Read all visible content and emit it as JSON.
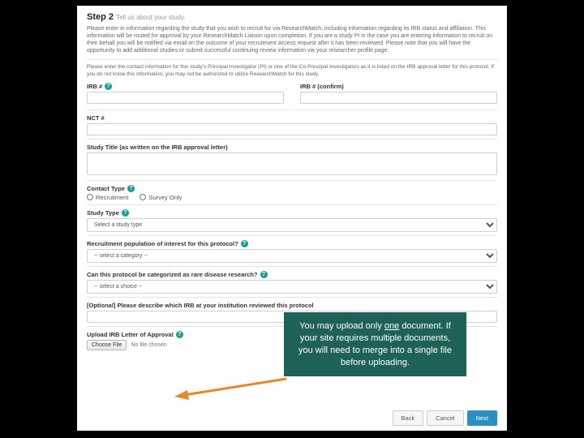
{
  "step": {
    "num": "Step 2",
    "sub": "Tell us about your study."
  },
  "intro": "Please enter in information regarding the study that you wish to recruit for via ResearchMatch, including information regarding its IRB status and affiliation. This information will be routed for approval by your ResearchMatch Liaison upon completion. If you are a study PI in the case you are entering information to recruit on their behalf you will be notified via email on the outcome of your recruitment access request after it has been reviewed. Please note that you will have the opportunity to add additional studies or submit successful continuing review information via your researcher profile page.",
  "pi_note": "Please enter the contact information for this study's Principal Investigator (PI) or one of the Co-Principal Investigators as it is listed on the IRB approval letter for this protocol. If you do not know this information, you may not be authorized to utilize ResearchMatch for this study.",
  "labels": {
    "irb": "IRB #",
    "irb_confirm": "IRB # (confirm)",
    "nct": "NCT #",
    "title": "Study Title (as written on the IRB approval letter)",
    "contact": "Contact Type",
    "recruitment": "Recruitment",
    "survey": "Survey Only",
    "studytype": "Study Type",
    "studytype_ph": "Select a study type",
    "pop": "Recruitment population of interest for this protocol?",
    "pop_ph": "-- select a category --",
    "rare": "Can this protocol be categorized as rare disease research?",
    "rare_ph": "-- select a choice --",
    "opt": "[Optional] Please describe which IRB at your institution reviewed this protocol",
    "upload": "Upload IRB Letter of Approval",
    "choose": "Choose File",
    "nofile": "No file chosen"
  },
  "buttons": {
    "back": "Back",
    "cancel": "Cancel",
    "next": "Next"
  },
  "callout": {
    "l1": "You may upload only ",
    "u": "one",
    "l2": " document. If your site requires multiple documents, you will need to merge into a single file before uploading."
  }
}
